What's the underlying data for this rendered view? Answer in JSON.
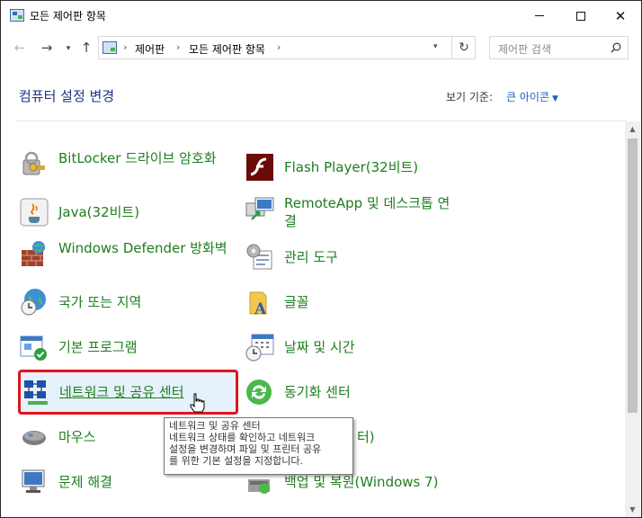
{
  "window": {
    "title": "모든 제어판 항목",
    "controls": {
      "minimize": "minimize",
      "maximize": "maximize",
      "close": "✕"
    }
  },
  "nav": {
    "back": "←",
    "forward": "→",
    "up": "↑",
    "breadcrumbs": [
      "제어판",
      "모든 제어판 항목"
    ],
    "separator": "›",
    "refresh": "↻",
    "search_placeholder": "제어판 검색"
  },
  "header": {
    "title": "컴퓨터 설정 변경",
    "view_by_label": "보기 기준:",
    "view_by_value": "큰 아이콘",
    "view_by_caret": "▼"
  },
  "items": {
    "bitlocker": "BitLocker 드라이브 암호화",
    "flash": "Flash Player(32비트)",
    "java": "Java(32비트)",
    "remoteapp": "RemoteApp 및 데스크톱 연결",
    "defender": "Windows Defender 방화벽",
    "admintools": "관리 도구",
    "region": "국가 또는 지역",
    "fonts": "글꼴",
    "defaultprograms": "기본 프로그램",
    "datetime": "날짜 및 시간",
    "network": "네트워크 및 공유 센터",
    "sync": "동기화 센터",
    "mouse": "마우스",
    "hidden_partial": "터)",
    "troubleshoot": "문제 해결",
    "backup": "백업 및 복원(Windows 7)"
  },
  "tooltip": {
    "line1": "네트워크 및 공유 센터",
    "line2": "네트워크 상태를 확인하고 네트워크",
    "line3": "설정을 변경하며 파일 및 프린터 공유",
    "line4": "를 위한 기본 설정을 지정합니다."
  },
  "colors": {
    "link_green": "#1e7e1e",
    "heading_blue": "#1e3287",
    "highlight_red": "#e3141b"
  }
}
